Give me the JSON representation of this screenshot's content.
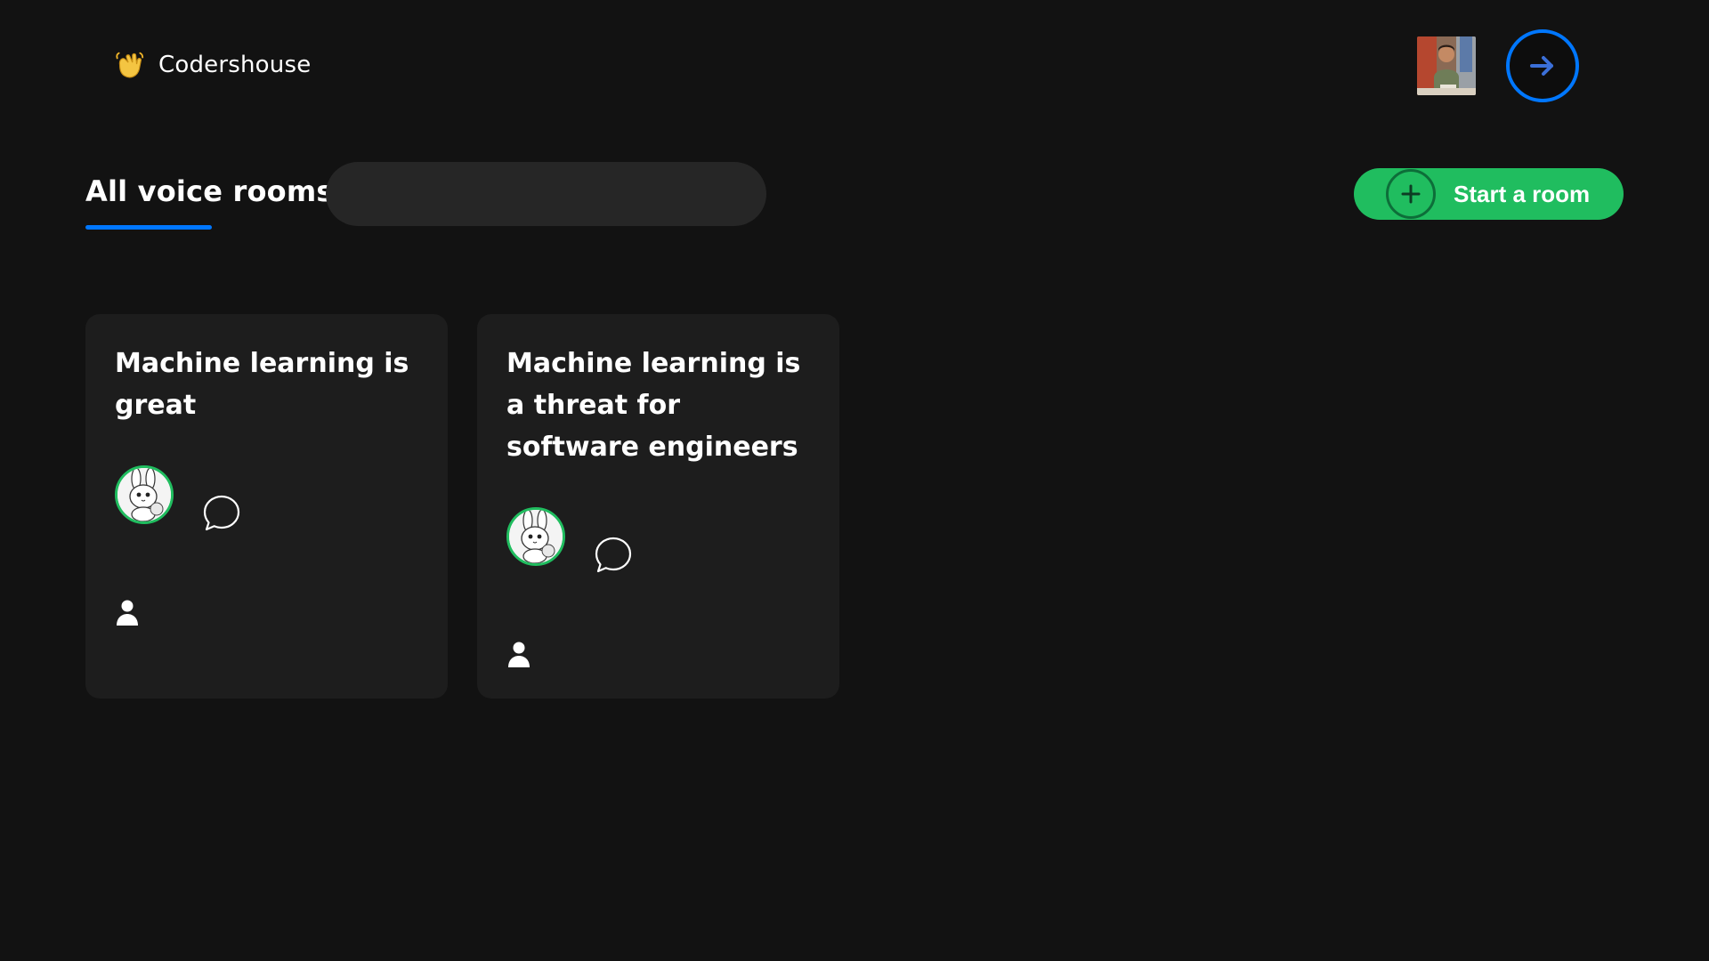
{
  "header": {
    "brand": "Codershouse",
    "brand_icon": "waving-hand-icon",
    "profile_avatar_icon": "user-photo",
    "logout_icon": "arrow-right-icon"
  },
  "rooms_toolbar": {
    "title": "All voice rooms",
    "search_value": "",
    "start_room_label": "Start a room",
    "start_room_icon": "plus-icon"
  },
  "rooms": [
    {
      "topic": "Machine learning is great",
      "speaker_avatar": "bunny-avatar",
      "chat_icon": "chat-bubble-icon",
      "people_icon": "person-icon",
      "people_count": ""
    },
    {
      "topic": "Machine learning is a threat for software engineers",
      "speaker_avatar": "bunny-avatar",
      "chat_icon": "chat-bubble-icon",
      "people_icon": "person-icon",
      "people_count": ""
    }
  ],
  "colors": {
    "background": "#121212",
    "card": "#1d1d1d",
    "accent_blue": "#0077ff",
    "accent_green": "#20bd5f",
    "search_bg": "#262626"
  }
}
